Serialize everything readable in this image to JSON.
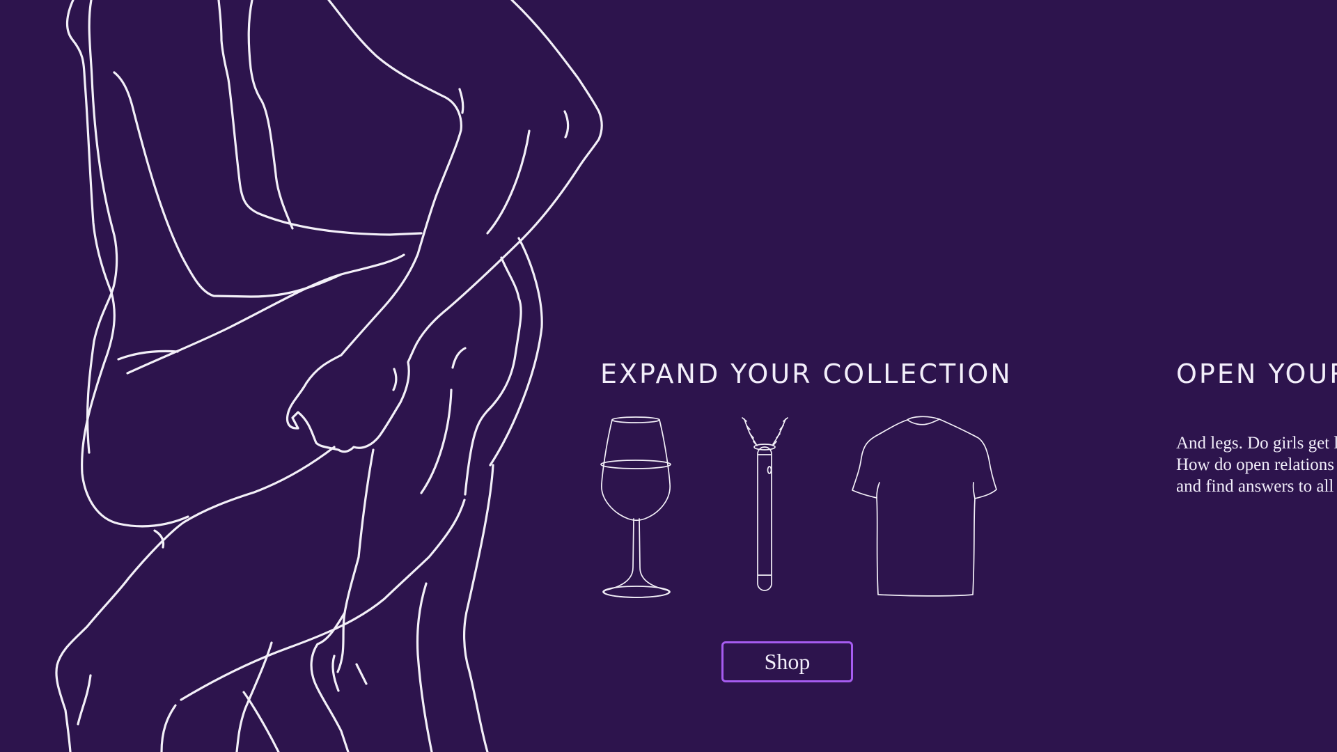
{
  "colors": {
    "background": "#2d144d",
    "line_art": "#f3f0f8",
    "text": "#f2eefa",
    "button_border": "#a65cf0"
  },
  "collection": {
    "heading": "EXPAND YOUR COLLECTION",
    "products": [
      {
        "icon": "wine-glass-icon"
      },
      {
        "icon": "necklace-icon"
      },
      {
        "icon": "t-shirt-icon"
      }
    ],
    "shop_label": "Shop"
  },
  "relationships": {
    "heading": "OPEN YOUR",
    "lines": [
      "And legs. Do girls get l",
      "How do open relations",
      "and find answers to all"
    ]
  },
  "illustration": {
    "icon": "figure-line-art-icon"
  }
}
